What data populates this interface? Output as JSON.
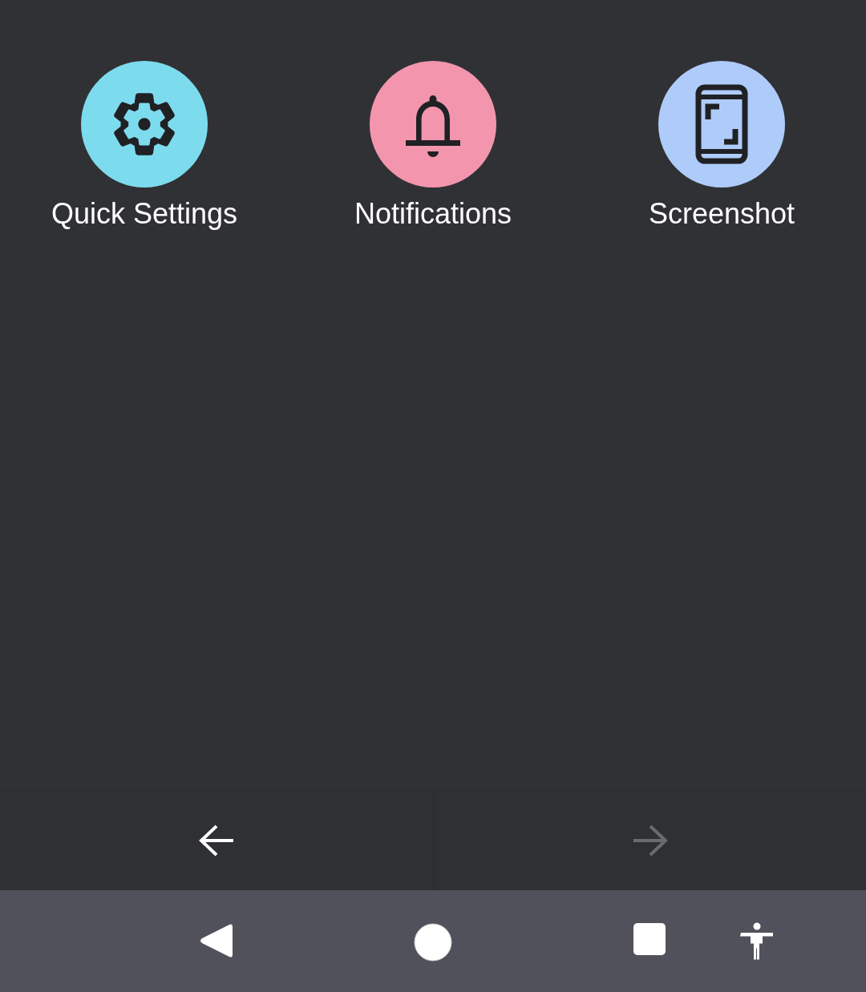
{
  "shortcuts": [
    {
      "kind": "settings",
      "label": "Quick Settings",
      "color": "#7ddbee"
    },
    {
      "kind": "notifications",
      "label": "Notifications",
      "color": "#f396ad"
    },
    {
      "kind": "screenshot",
      "label": "Screenshot",
      "color": "#aecbfa"
    }
  ],
  "page_nav": [
    {
      "kind": "previous",
      "disabled": false
    },
    {
      "kind": "next",
      "disabled": true
    }
  ]
}
